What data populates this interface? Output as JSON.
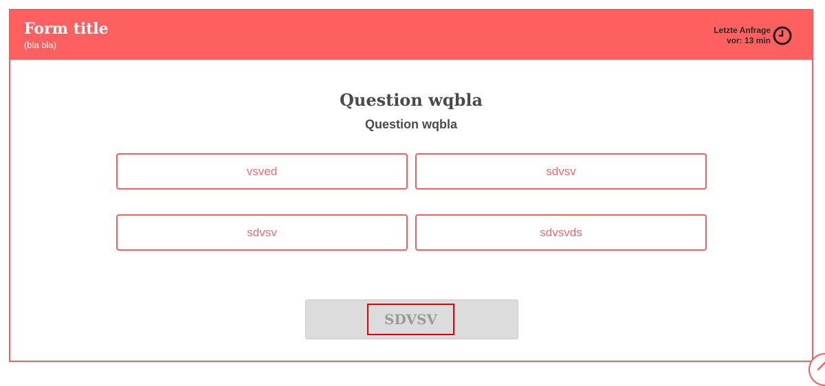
{
  "header": {
    "title": "Form title",
    "subtitle": "(bla bla)",
    "last_request_label": "Letzte Anfrage",
    "last_request_time": "vor: 13 min",
    "clock_icon": "clock-icon"
  },
  "question": {
    "title": "Question wqbla",
    "subtitle": "Question wqbla"
  },
  "options": [
    "vsved",
    "sdvsv",
    "sdvsv",
    "sdvsvds"
  ],
  "submit": {
    "label": "SDVSV"
  },
  "colors": {
    "header_bg": "#fe5f5f",
    "accent": "#ef5f5f",
    "option_text": "#ef6b6b",
    "button_bg": "#dcdcdc",
    "highlight": "#e00000"
  }
}
